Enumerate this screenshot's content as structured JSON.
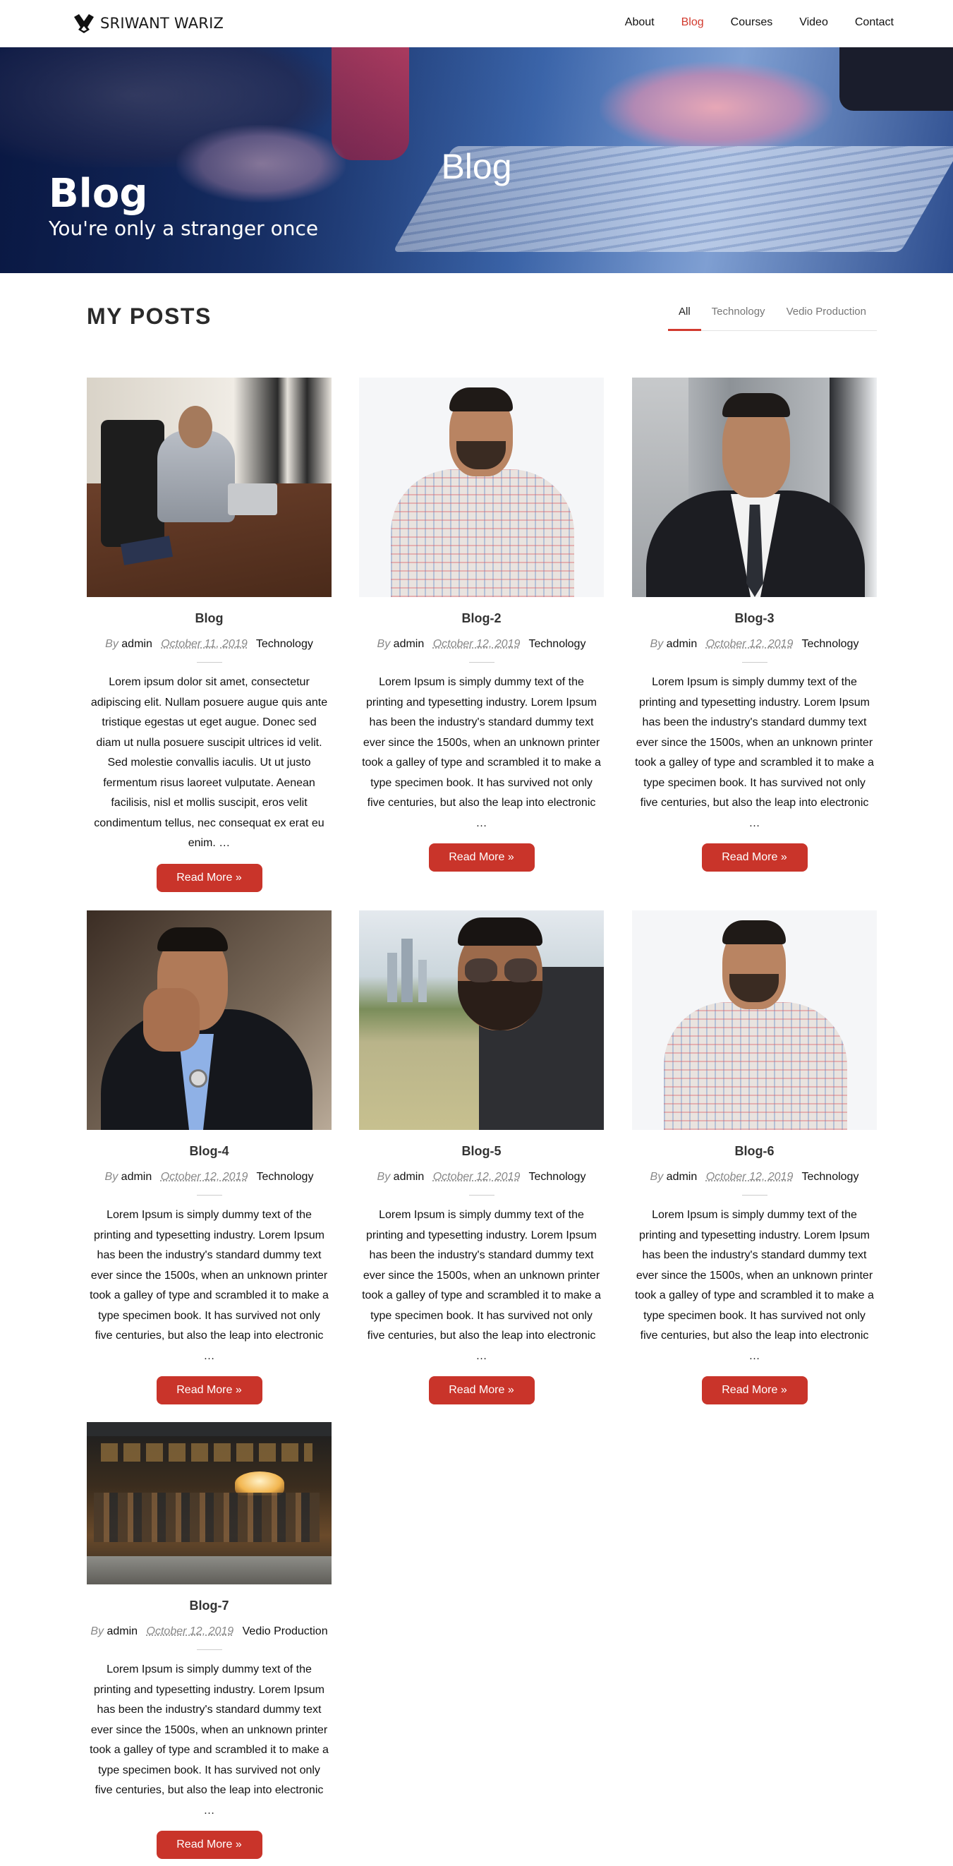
{
  "brand": {
    "name": "SRIWANT WARIZ",
    "logo_icon": "wariz-logo-icon"
  },
  "nav": {
    "items": [
      {
        "label": "About",
        "active": false
      },
      {
        "label": "Blog",
        "active": true
      },
      {
        "label": "Courses",
        "active": false
      },
      {
        "label": "Video",
        "active": false
      },
      {
        "label": "Contact",
        "active": false
      }
    ]
  },
  "hero": {
    "title": "Blog",
    "subtitle": "You're only a stranger once",
    "page_heading": "Blog"
  },
  "posts_section": {
    "title": "MY POSTS",
    "filters": [
      {
        "label": "All",
        "active": true
      },
      {
        "label": "Technology",
        "active": false
      },
      {
        "label": "Vedio Production",
        "active": false
      }
    ]
  },
  "posts": [
    {
      "title": "Blog",
      "by": "By",
      "author": "admin",
      "date": "October 11, 2019",
      "category": "Technology",
      "excerpt": "Lorem ipsum dolor sit amet, consectetur adipiscing elit. Nullam posuere augue quis ante tristique egestas ut eget augue. Donec sed diam ut nulla posuere suscipit ultrices id velit. Sed molestie convallis iaculis. Ut ut justo fermentum risus laoreet vulputate. Aenean facilisis, nisl et mollis suscipit, eros velit condimentum tellus, nec consequat ex erat eu enim. …",
      "button": "Read More »"
    },
    {
      "title": "Blog-2",
      "by": "By",
      "author": "admin",
      "date": "October 12, 2019",
      "category": "Technology",
      "excerpt": "Lorem Ipsum is simply dummy text of the printing and typesetting industry. Lorem Ipsum has been the industry's standard dummy text ever since the 1500s, when an unknown printer took a galley of type and scrambled it to make a type specimen book. It has survived not only five centuries, but also the leap into electronic …",
      "button": "Read More »"
    },
    {
      "title": "Blog-3",
      "by": "By",
      "author": "admin",
      "date": "October 12, 2019",
      "category": "Technology",
      "excerpt": "Lorem Ipsum is simply dummy text of the printing and typesetting industry. Lorem Ipsum has been the industry's standard dummy text ever since the 1500s, when an unknown printer took a galley of type and scrambled it to make a type specimen book. It has survived not only five centuries, but also the leap into electronic …",
      "button": "Read More »"
    },
    {
      "title": "Blog-4",
      "by": "By",
      "author": "admin",
      "date": "October 12, 2019",
      "category": "Technology",
      "excerpt": "Lorem Ipsum is simply dummy text of the printing and typesetting industry. Lorem Ipsum has been the industry's standard dummy text ever since the 1500s, when an unknown printer took a galley of type and scrambled it to make a type specimen book. It has survived not only five centuries, but also the leap into electronic …",
      "button": "Read More »"
    },
    {
      "title": "Blog-5",
      "by": "By",
      "author": "admin",
      "date": "October 12, 2019",
      "category": "Technology",
      "excerpt": "Lorem Ipsum is simply dummy text of the printing and typesetting industry. Lorem Ipsum has been the industry's standard dummy text ever since the 1500s, when an unknown printer took a galley of type and scrambled it to make a type specimen book. It has survived not only five centuries, but also the leap into electronic …",
      "button": "Read More »"
    },
    {
      "title": "Blog-6",
      "by": "By",
      "author": "admin",
      "date": "October 12, 2019",
      "category": "Technology",
      "excerpt": "Lorem Ipsum is simply dummy text of the printing and typesetting industry. Lorem Ipsum has been the industry's standard dummy text ever since the 1500s, when an unknown printer took a galley of type and scrambled it to make a type specimen book. It has survived not only five centuries, but also the leap into electronic …",
      "button": "Read More »"
    },
    {
      "title": "Blog-7",
      "by": "By",
      "author": "admin",
      "date": "October 12, 2019",
      "category": "Vedio Production",
      "excerpt": "Lorem Ipsum is simply dummy text of the printing and typesetting industry. Lorem Ipsum has been the industry's standard dummy text ever since the 1500s, when an unknown printer took a galley of type and scrambled it to make a type specimen book. It has survived not only five centuries, but also the leap into electronic …",
      "button": "Read More »"
    }
  ],
  "colors": {
    "accent": "#d23a2e",
    "button": "#c9342a",
    "hero_dark": "#0c1f4f",
    "hero_light": "#7f9fd2"
  }
}
